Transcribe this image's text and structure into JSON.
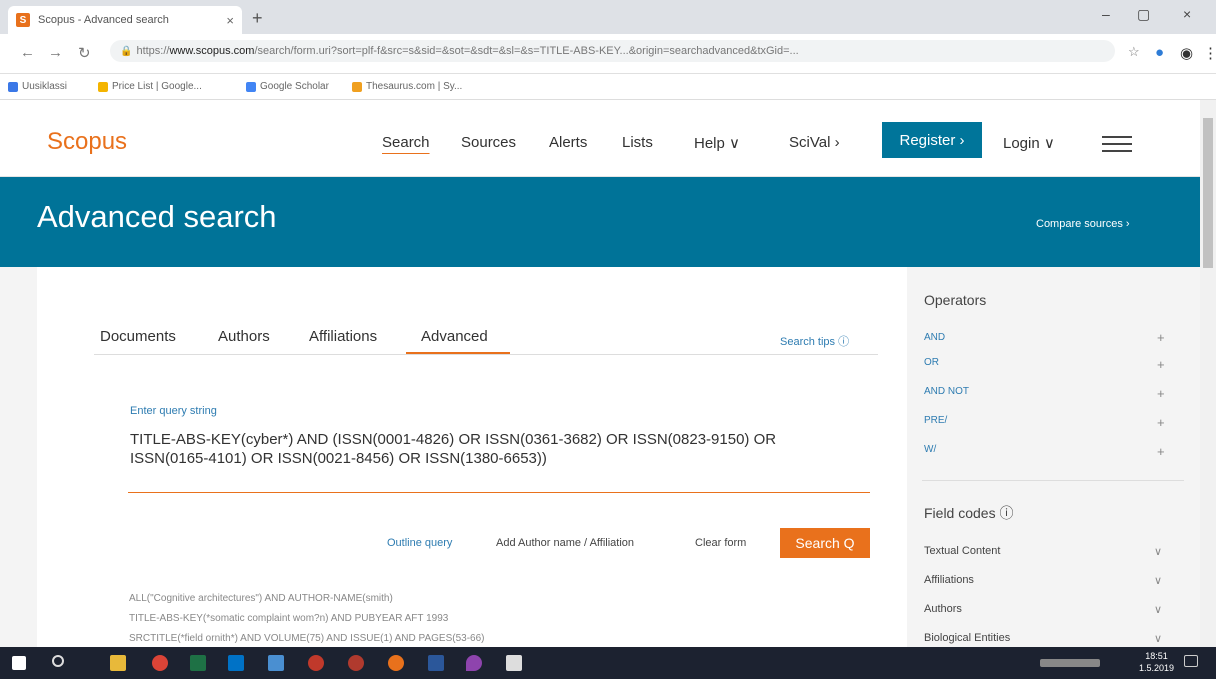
{
  "browser": {
    "tab_title": "Scopus - Advanced search",
    "tab_close": "×",
    "new_tab": "+",
    "win_min": "–",
    "win_max": "▢",
    "win_close": "×",
    "url_prefix": "https://",
    "url_host": "www.scopus.com",
    "url_path": "/search/form.uri?sort=plf-f&src=s&sid=&sot=&sdt=&sl=&s=TITLE-ABS-KEY...&origin=searchadvanced&txGid=...",
    "bookmarks": [
      "Uusiklassi",
      "Price List | Google...",
      "Google Scholar",
      "Thesaurus.com | Sy..."
    ]
  },
  "header": {
    "logo": "Scopus",
    "nav": [
      "Search",
      "Sources",
      "Alerts",
      "Lists",
      "Help ∨",
      "SciVal ›"
    ],
    "register": "Register ›",
    "login": "Login ∨"
  },
  "banner": {
    "title": "Advanced search",
    "compare": "Compare sources ›"
  },
  "tabs": [
    "Documents",
    "Authors",
    "Affiliations",
    "Advanced"
  ],
  "search_tips": "Search tips ⓘ",
  "query": {
    "label": "Enter query string",
    "line1": "TITLE-ABS-KEY(cyber*) AND (ISSN(0001-4826) OR ISSN(0361-3682) OR ISSN(0823-9150) OR",
    "line2": "ISSN(0165-4101) OR ISSN(0021-8456) OR ISSN(1380-6653))"
  },
  "actions": {
    "outline": "Outline query",
    "add_author": "Add Author name / Affiliation",
    "clear": "Clear form",
    "search": "Search Q"
  },
  "examples": [
    "ALL(\"Cognitive architectures\") AND AUTHOR-NAME(smith)",
    "TITLE-ABS-KEY(*somatic complaint wom?n) AND PUBYEAR AFT 1993",
    "SRCTITLE(*field ornith*) AND VOLUME(75) AND ISSUE(1) AND PAGES(53-66)"
  ],
  "sidebar": {
    "operators_title": "Operators",
    "operators": [
      "AND",
      "OR",
      "AND NOT",
      "PRE/",
      "W/"
    ],
    "field_codes_title": "Field codes ⓘ",
    "field_codes": [
      "Textual Content",
      "Affiliations",
      "Authors",
      "Biological Entities"
    ]
  },
  "taskbar": {
    "time": "18:51",
    "date": "1.5.2019"
  }
}
